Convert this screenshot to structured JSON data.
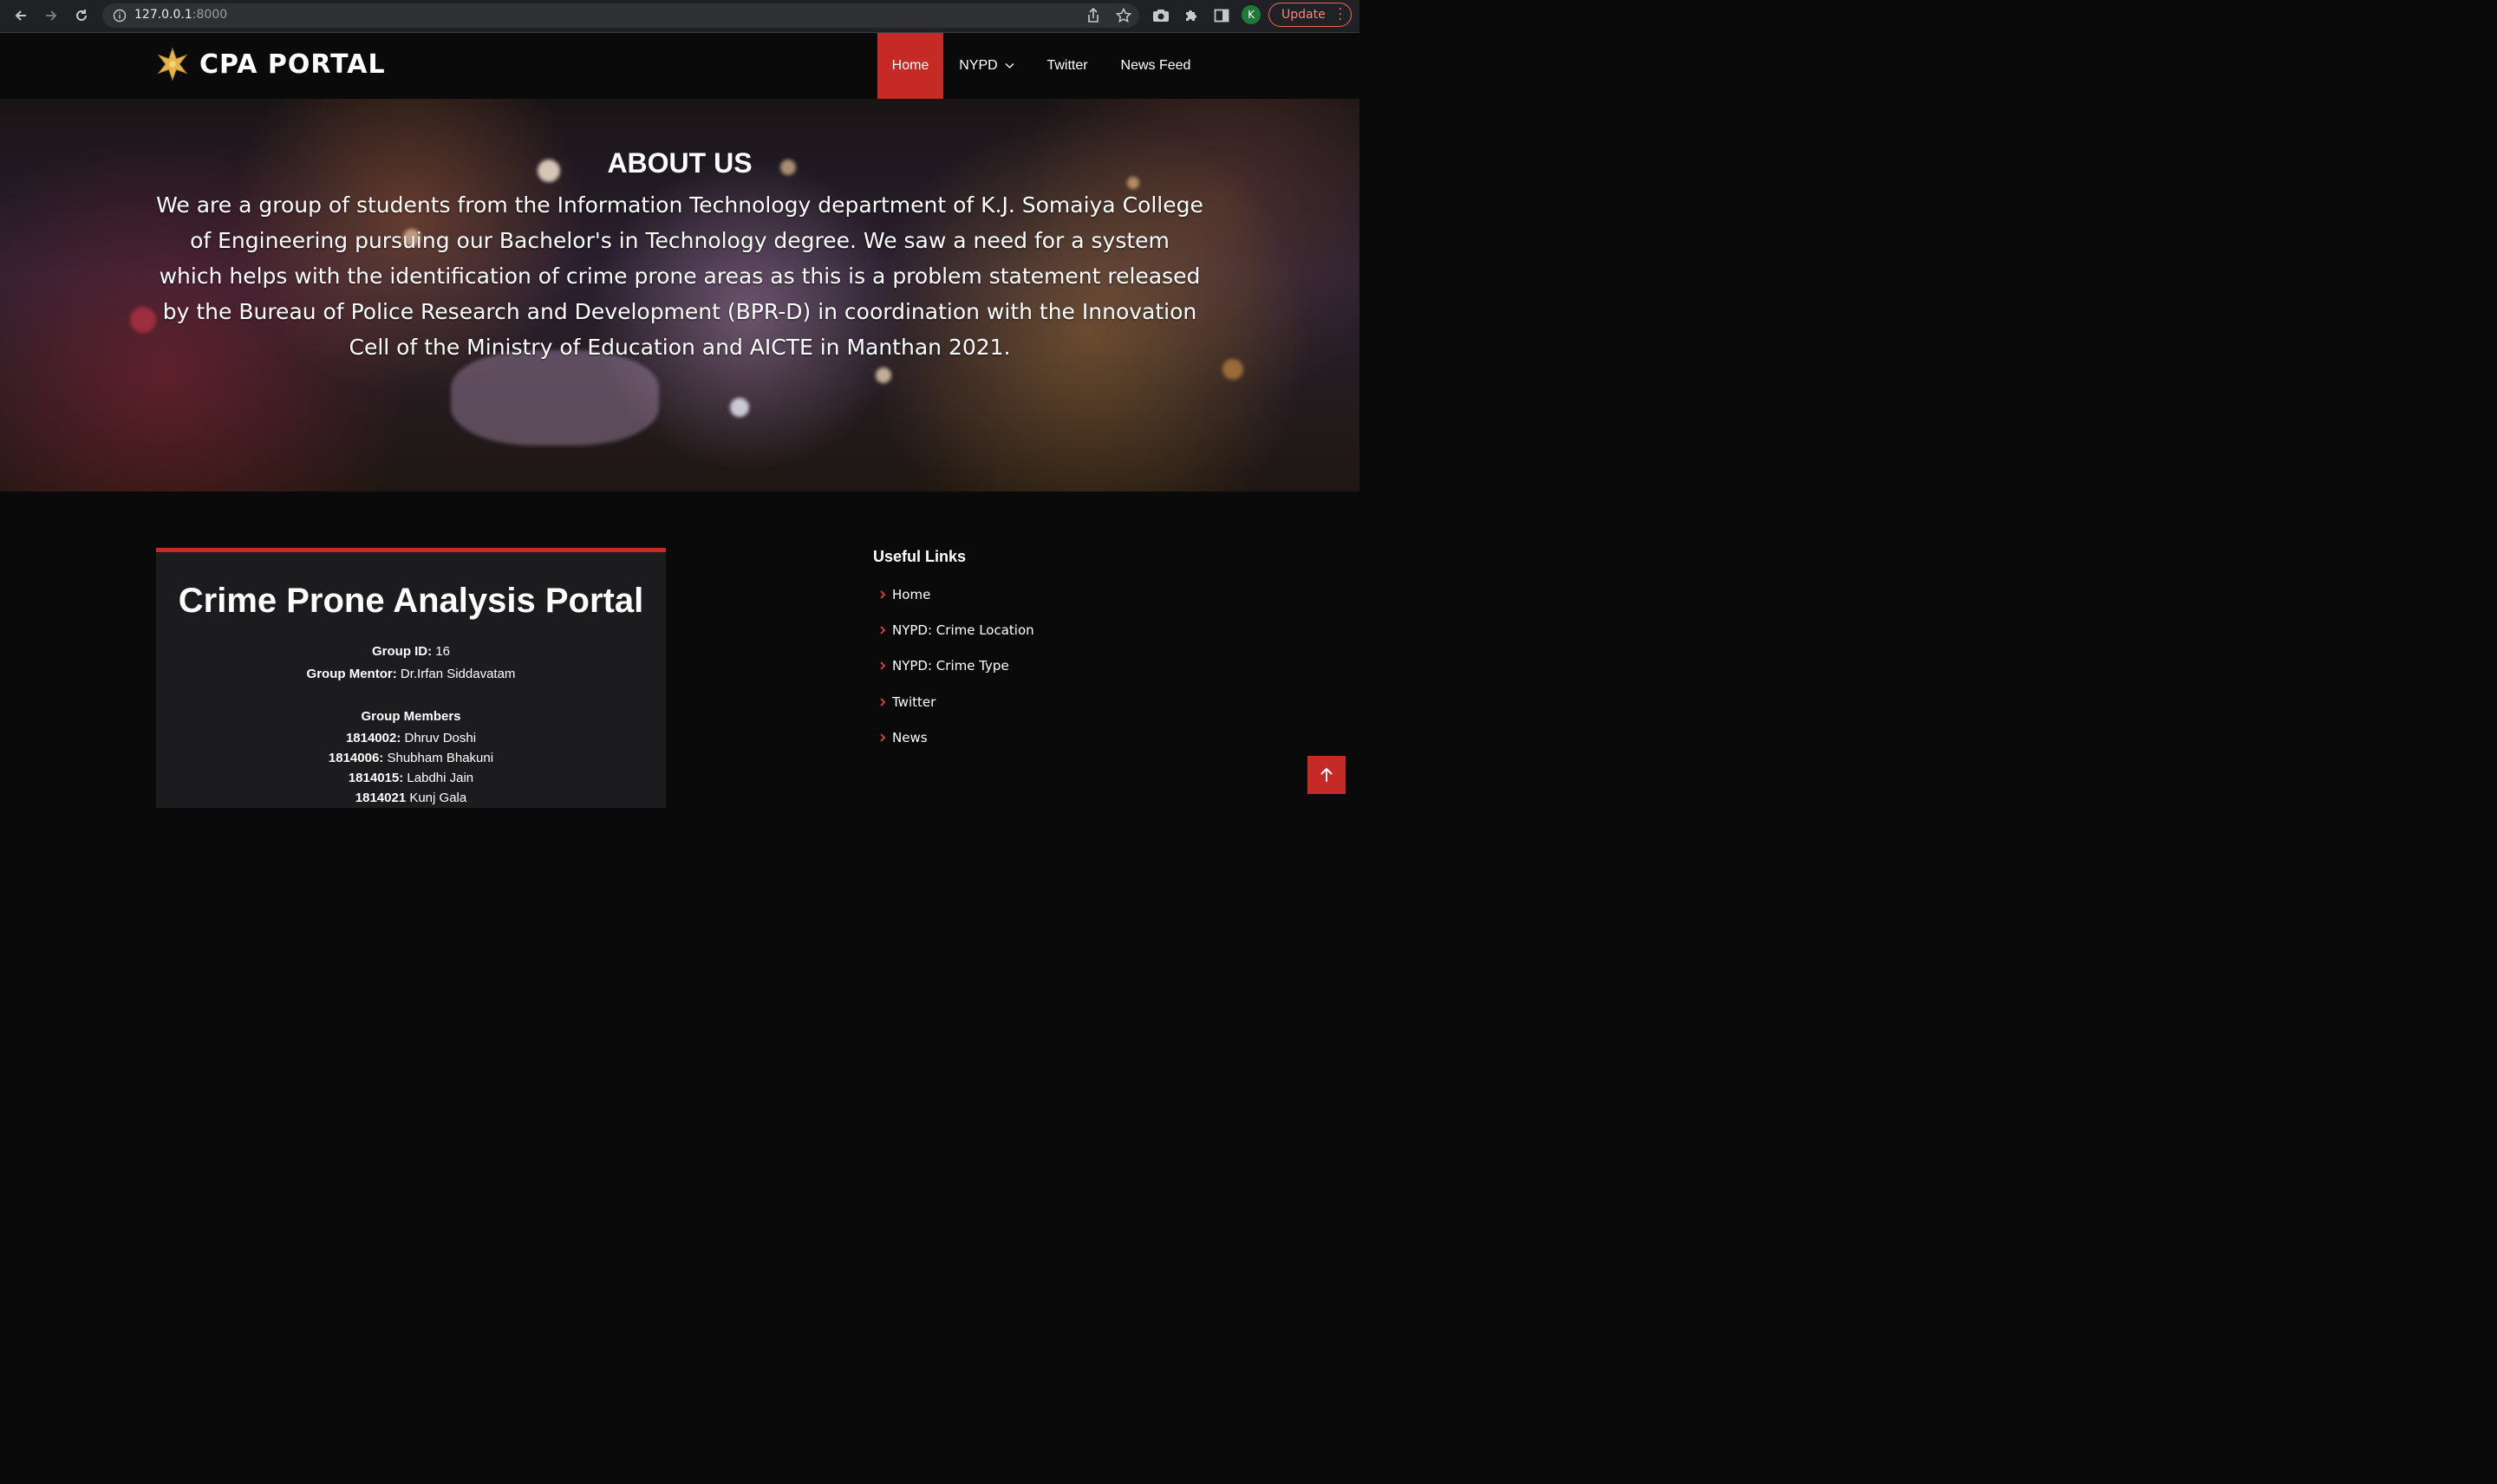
{
  "browser": {
    "url_host": "127.0.0.1",
    "url_port": ":8000",
    "avatar_letter": "K",
    "update_label": "Update"
  },
  "header": {
    "logo_text": "CPA PORTAL",
    "nav": [
      {
        "label": "Home"
      },
      {
        "label": "NYPD"
      },
      {
        "label": "Twitter"
      },
      {
        "label": "News Feed"
      }
    ]
  },
  "hero": {
    "title": "ABOUT US",
    "paragraph": "We are a group of students from the Information Technology department of K.J. Somaiya College of Engineering pursuing our Bachelor's in Technology degree. We saw a need for a system which helps with the identification of crime prone areas as this is a problem statement released by the Bureau of Police Research and Development (BPR-D) in coordination with the Innovation Cell of the Ministry of Education and AICTE in Manthan 2021."
  },
  "card": {
    "title": "Crime Prone Analysis Portal",
    "group_id_label": "Group ID:",
    "group_id_value": " 16",
    "mentor_label": "Group Mentor:",
    "mentor_value": " Dr.Irfan Siddavatam",
    "members_heading": "Group Members",
    "members": [
      {
        "id": "1814002:",
        "name": " Dhruv Doshi"
      },
      {
        "id": "1814006:",
        "name": " Shubham Bhakuni"
      },
      {
        "id": "1814015:",
        "name": " Labdhi Jain"
      },
      {
        "id": "1814021",
        "name": " Kunj Gala"
      }
    ]
  },
  "useful_links": {
    "heading": "Useful Links",
    "items": [
      {
        "label": "Home"
      },
      {
        "label": "NYPD: Crime Location"
      },
      {
        "label": "NYPD: Crime Type"
      },
      {
        "label": "Twitter"
      },
      {
        "label": "News"
      }
    ]
  },
  "colors": {
    "accent": "#c62a27",
    "background": "#0a0a0b",
    "card": "#1c1c1e"
  }
}
